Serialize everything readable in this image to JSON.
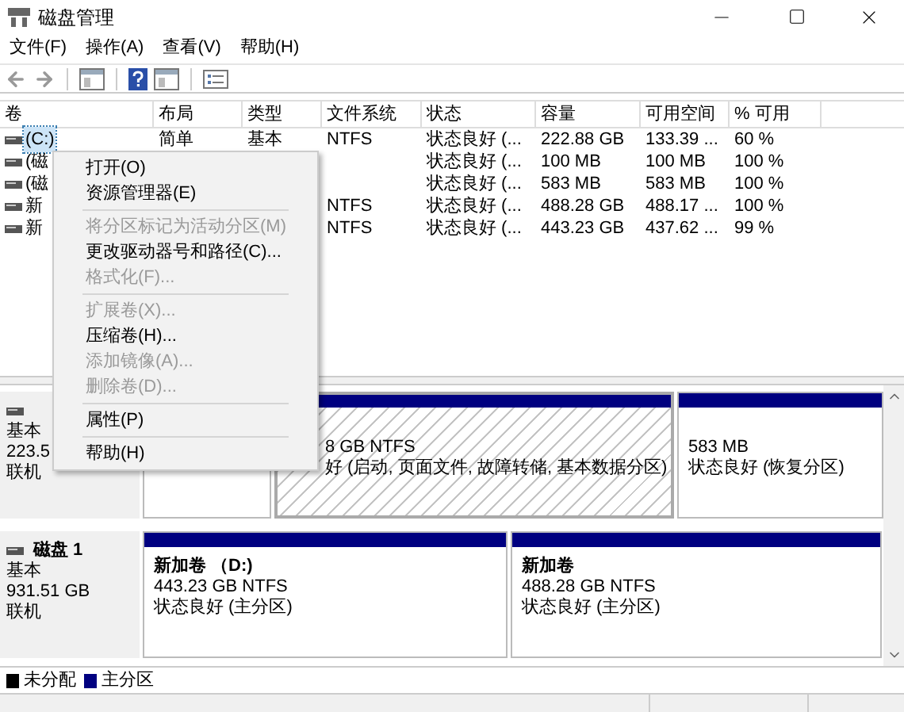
{
  "window": {
    "title": "磁盘管理"
  },
  "menu_bar": [
    "文件(F)",
    "操作(A)",
    "查看(V)",
    "帮助(H)"
  ],
  "volume_table": {
    "columns": [
      "卷",
      "布局",
      "类型",
      "文件系统",
      "状态",
      "容量",
      "可用空间",
      "% 可用"
    ],
    "rows": [
      {
        "volume": "(C:)",
        "layout": "简单",
        "type": "基本",
        "file_system": "NTFS",
        "status": "状态良好 (...",
        "capacity": "222.88 GB",
        "free_space": "133.39 ...",
        "percent_free": "60 %",
        "selected": true
      },
      {
        "volume": "(磁",
        "status": "状态良好 (...",
        "capacity": "100 MB",
        "free_space": "100 MB",
        "percent_free": "100 %",
        "selected": false
      },
      {
        "volume": "(磁",
        "status": "状态良好 (...",
        "capacity": "583 MB",
        "free_space": "583 MB",
        "percent_free": "100 %",
        "selected": false
      },
      {
        "volume": "新",
        "file_system": "NTFS",
        "status": "状态良好 (...",
        "capacity": "488.28 GB",
        "free_space": "488.17 ...",
        "percent_free": "100 %",
        "selected": false
      },
      {
        "volume": "新",
        "file_system": "NTFS",
        "status": "状态良好 (...",
        "capacity": "443.23 GB",
        "free_space": "437.62 ...",
        "percent_free": "99 %",
        "selected": false
      }
    ]
  },
  "context_menu": {
    "items": [
      {
        "kind": "item",
        "label": "打开(O)",
        "disabled": false
      },
      {
        "kind": "item",
        "label": "资源管理器(E)",
        "disabled": false
      },
      {
        "kind": "separator"
      },
      {
        "kind": "item",
        "label": "将分区标记为活动分区(M)",
        "disabled": true
      },
      {
        "kind": "item",
        "label": "更改驱动器号和路径(C)...",
        "disabled": false
      },
      {
        "kind": "item",
        "label": "格式化(F)...",
        "disabled": true
      },
      {
        "kind": "separator"
      },
      {
        "kind": "item",
        "label": "扩展卷(X)...",
        "disabled": true
      },
      {
        "kind": "item",
        "label": "压缩卷(H)...",
        "disabled": false
      },
      {
        "kind": "item",
        "label": "添加镜像(A)...",
        "disabled": true
      },
      {
        "kind": "item",
        "label": "删除卷(D)...",
        "disabled": true
      },
      {
        "kind": "separator"
      },
      {
        "kind": "item",
        "label": "属性(P)",
        "disabled": false
      },
      {
        "kind": "separator"
      },
      {
        "kind": "item",
        "label": "帮助(H)",
        "disabled": false
      }
    ]
  },
  "disks": [
    {
      "type": "基本",
      "size": "223.5",
      "state": "联机",
      "partitions": [
        {
          "selected": false
        },
        {
          "size": "8 GB NTFS",
          "status": "好 (启动, 页面文件, 故障转储, 基本数据分区)",
          "selected": true
        },
        {
          "size": "583 MB",
          "status": "状态良好 (恢复分区)",
          "selected": false
        }
      ]
    },
    {
      "name": "磁盘 1",
      "type": "基本",
      "size": "931.51 GB",
      "state": "联机",
      "partitions": [
        {
          "name": "新加卷 （D:)",
          "size": "443.23 GB NTFS",
          "status": "状态良好 (主分区)",
          "selected": false
        },
        {
          "name": "新加卷",
          "size": "488.28 GB NTFS",
          "status": "状态良好 (主分区)",
          "selected": false
        }
      ]
    }
  ],
  "legend": [
    {
      "label": "未分配",
      "color": "#000000"
    },
    {
      "label": "主分区",
      "color": "#000080"
    }
  ]
}
